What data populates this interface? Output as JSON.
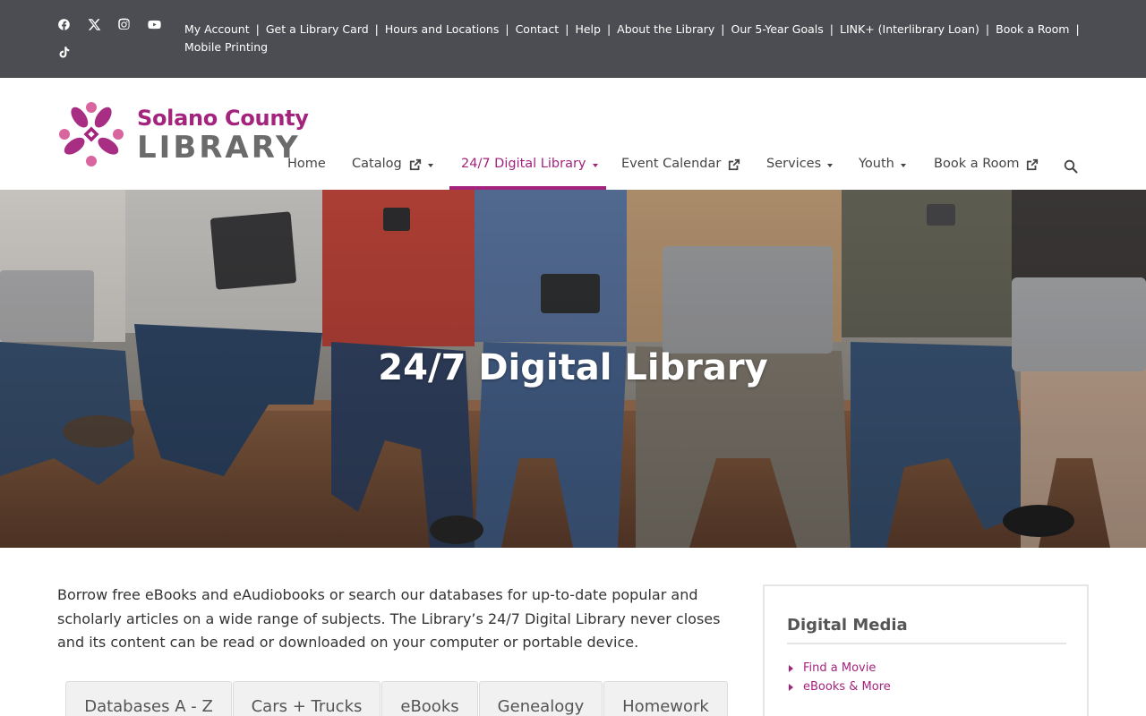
{
  "topbar": {
    "social": [
      "facebook-icon",
      "x-icon",
      "instagram-icon",
      "youtube-icon",
      "tiktok-icon"
    ],
    "links": [
      "My Account",
      "Get a Library Card",
      "Hours and Locations",
      "Contact",
      "Help",
      "About the Library",
      "Our 5-Year Goals",
      "LINK+ (Interlibrary Loan)",
      "Book a Room",
      "Mobile Printing"
    ],
    "separator": "|"
  },
  "logo": {
    "line1": "Solano County",
    "line2": "LIBRARY"
  },
  "nav": {
    "items": [
      {
        "label": "Home"
      },
      {
        "label": "Catalog"
      },
      {
        "label": "24/7 Digital Library"
      },
      {
        "label": "Event Calendar"
      },
      {
        "label": "Services"
      },
      {
        "label": "Youth"
      },
      {
        "label": "Book a Room"
      }
    ],
    "active": "24/7 Digital Library"
  },
  "hero": {
    "title": "24/7 Digital Library"
  },
  "main": {
    "intro": "Borrow free eBooks and eAudiobooks or search our databases for up-to-date popular and scholarly articles on a wide range of subjects. The Library’s 24/7 Digital Library  never closes and its content can be read or downloaded on your computer or portable device.",
    "tabs": [
      "Databases A - Z",
      "Cars + Trucks",
      "eBooks",
      "Genealogy",
      "Homework"
    ]
  },
  "sidebar": {
    "title": "Digital Media",
    "links": [
      "Find a Movie",
      "eBooks & More"
    ]
  },
  "colors": {
    "brand": "#a3237d",
    "topbar": "#4b4d52",
    "logo_gray": "#6b6b6b"
  }
}
